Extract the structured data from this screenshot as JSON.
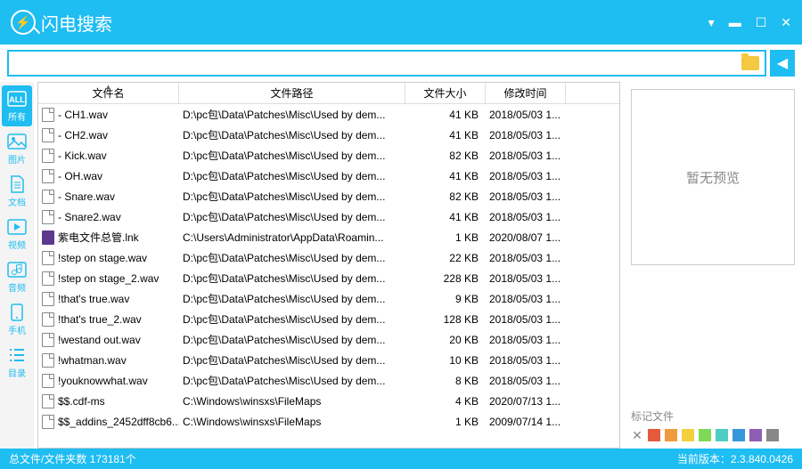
{
  "app": {
    "title": "闪电搜索"
  },
  "search": {
    "placeholder": ""
  },
  "sidebar": [
    {
      "label": "所有"
    },
    {
      "label": "图片"
    },
    {
      "label": "文档"
    },
    {
      "label": "视频"
    },
    {
      "label": "音频"
    },
    {
      "label": "手机"
    },
    {
      "label": "目录"
    }
  ],
  "columns": {
    "name": "文件名",
    "path": "文件路径",
    "size": "文件大小",
    "mtime": "修改时间"
  },
  "rows": [
    {
      "name": " - CH1.wav",
      "path": "D:\\pc包\\Data\\Patches\\Misc\\Used by dem...",
      "size": "41 KB",
      "mtime": "2018/05/03 1...",
      "icon": "file"
    },
    {
      "name": " - CH2.wav",
      "path": "D:\\pc包\\Data\\Patches\\Misc\\Used by dem...",
      "size": "41 KB",
      "mtime": "2018/05/03 1...",
      "icon": "file"
    },
    {
      "name": " - Kick.wav",
      "path": "D:\\pc包\\Data\\Patches\\Misc\\Used by dem...",
      "size": "82 KB",
      "mtime": "2018/05/03 1...",
      "icon": "file"
    },
    {
      "name": " - OH.wav",
      "path": "D:\\pc包\\Data\\Patches\\Misc\\Used by dem...",
      "size": "41 KB",
      "mtime": "2018/05/03 1...",
      "icon": "file"
    },
    {
      "name": " - Snare.wav",
      "path": "D:\\pc包\\Data\\Patches\\Misc\\Used by dem...",
      "size": "82 KB",
      "mtime": "2018/05/03 1...",
      "icon": "file"
    },
    {
      "name": " - Snare2.wav",
      "path": "D:\\pc包\\Data\\Patches\\Misc\\Used by dem...",
      "size": "41 KB",
      "mtime": "2018/05/03 1...",
      "icon": "file"
    },
    {
      "name": "紫电文件总管.lnk",
      "path": "C:\\Users\\Administrator\\AppData\\Roamin...",
      "size": "1 KB",
      "mtime": "2020/08/07 1...",
      "icon": "purple"
    },
    {
      "name": "!step on stage.wav",
      "path": "D:\\pc包\\Data\\Patches\\Misc\\Used by dem...",
      "size": "22 KB",
      "mtime": "2018/05/03 1...",
      "icon": "file"
    },
    {
      "name": "!step on stage_2.wav",
      "path": "D:\\pc包\\Data\\Patches\\Misc\\Used by dem...",
      "size": "228 KB",
      "mtime": "2018/05/03 1...",
      "icon": "file"
    },
    {
      "name": "!that's true.wav",
      "path": "D:\\pc包\\Data\\Patches\\Misc\\Used by dem...",
      "size": "9 KB",
      "mtime": "2018/05/03 1...",
      "icon": "file"
    },
    {
      "name": "!that's true_2.wav",
      "path": "D:\\pc包\\Data\\Patches\\Misc\\Used by dem...",
      "size": "128 KB",
      "mtime": "2018/05/03 1...",
      "icon": "file"
    },
    {
      "name": "!westand out.wav",
      "path": "D:\\pc包\\Data\\Patches\\Misc\\Used by dem...",
      "size": "20 KB",
      "mtime": "2018/05/03 1...",
      "icon": "file"
    },
    {
      "name": "!whatman.wav",
      "path": "D:\\pc包\\Data\\Patches\\Misc\\Used by dem...",
      "size": "10 KB",
      "mtime": "2018/05/03 1...",
      "icon": "file"
    },
    {
      "name": "!youknowwhat.wav",
      "path": "D:\\pc包\\Data\\Patches\\Misc\\Used by dem...",
      "size": "8 KB",
      "mtime": "2018/05/03 1...",
      "icon": "file"
    },
    {
      "name": "$$.cdf-ms",
      "path": "C:\\Windows\\winsxs\\FileMaps",
      "size": "4 KB",
      "mtime": "2020/07/13 1...",
      "icon": "file"
    },
    {
      "name": "$$_addins_2452dff8cb6...",
      "path": "C:\\Windows\\winsxs\\FileMaps",
      "size": "1 KB",
      "mtime": "2009/07/14 1...",
      "icon": "file"
    }
  ],
  "preview": {
    "empty": "暂无预览",
    "tag_label": "标记文件"
  },
  "tag_colors": [
    "#e55a3c",
    "#f09a3e",
    "#f4d03f",
    "#7ed957",
    "#4ecdc4",
    "#3498db",
    "#8e5eb5",
    "#888888"
  ],
  "status": {
    "left": "总文件/文件夹数 173181个",
    "right": "当前版本：2.3.840.0426"
  }
}
